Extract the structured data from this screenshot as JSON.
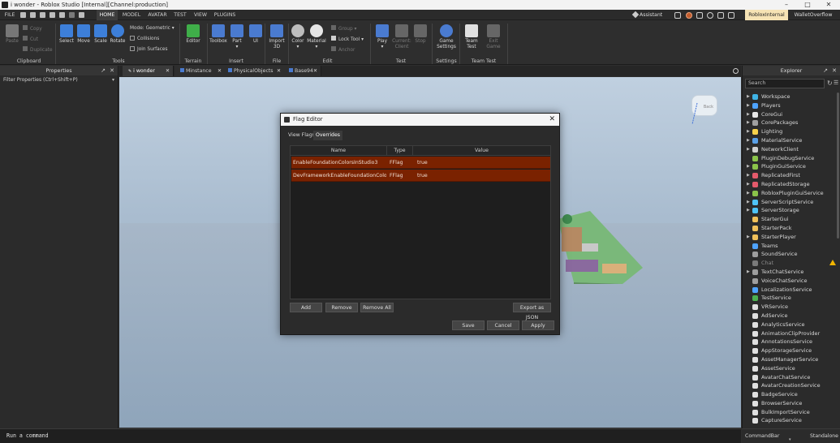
{
  "window": {
    "title": "i wonder - Roblox Studio [Internal][Channel:production]"
  },
  "menu": {
    "file": "FILE",
    "tabs": [
      "HOME",
      "MODEL",
      "AVATAR",
      "TEST",
      "VIEW",
      "PLUGINS"
    ],
    "active_tab": "HOME"
  },
  "topright": {
    "assistant": "Assistant",
    "account": "RobloxInternal",
    "user": "WalletOverflow"
  },
  "ribbon": {
    "clipboard": {
      "paste": "Paste",
      "copy": "Copy",
      "cut": "Cut",
      "duplicate": "Duplicate",
      "group": "Clipboard"
    },
    "tools": {
      "select": "Select",
      "move": "Move",
      "scale": "Scale",
      "rotate": "Rotate",
      "mode_label": "Mode:",
      "mode_value": "Geometric",
      "collisions": "Collisions",
      "join_surfaces": "Join Surfaces",
      "group": "Tools"
    },
    "terrain": {
      "editor": "Editor",
      "group": "Terrain"
    },
    "insert": {
      "toolbox": "Toolbox",
      "part": "Part",
      "ui": "UI",
      "group": "Insert"
    },
    "file": {
      "import3d_1": "Import",
      "import3d_2": "3D",
      "group": "File"
    },
    "edit": {
      "color": "Color",
      "material": "Material",
      "group_btn": "Group",
      "lock_tool": "Lock Tool",
      "anchor": "Anchor",
      "group": "Edit"
    },
    "test": {
      "play": "Play",
      "current_1": "Current:",
      "current_2": "Client",
      "stop": "Stop",
      "group": "Test"
    },
    "settings": {
      "game_1": "Game",
      "game_2": "Settings",
      "group": "Settings"
    },
    "teamtest": {
      "team_1": "Team",
      "team_2": "Test",
      "exit_1": "Exit",
      "exit_2": "Game",
      "group": "Team Test"
    }
  },
  "properties": {
    "title": "Properties",
    "filter": "Filter Properties (Ctrl+Shift+P)"
  },
  "tabs": [
    {
      "label": "i wonder"
    },
    {
      "label": "Minstance"
    },
    {
      "label": "PhysicalObjects"
    },
    {
      "label": "Base94"
    }
  ],
  "viewcube": {
    "label": "Back"
  },
  "explorer": {
    "title": "Explorer",
    "search_placeholder": "Search",
    "items": [
      {
        "label": "Workspace",
        "color": "#3fb3e5",
        "arrow": true
      },
      {
        "label": "Players",
        "color": "#4ea3ff",
        "arrow": true
      },
      {
        "label": "CoreGui",
        "color": "#e8e8e8",
        "arrow": true
      },
      {
        "label": "CorePackages",
        "color": "#a0a0a0",
        "arrow": true
      },
      {
        "label": "Lighting",
        "color": "#f5d14b",
        "arrow": true
      },
      {
        "label": "MaterialService",
        "color": "#5aa0e6",
        "arrow": true
      },
      {
        "label": "NetworkClient",
        "color": "#d0d0d0",
        "arrow": true
      },
      {
        "label": "PluginDebugService",
        "color": "#8bc34a",
        "arrow": false
      },
      {
        "label": "PluginGuiService",
        "color": "#8bc34a",
        "arrow": true
      },
      {
        "label": "ReplicatedFirst",
        "color": "#e55a6b",
        "arrow": true
      },
      {
        "label": "ReplicatedStorage",
        "color": "#e55a6b",
        "arrow": true
      },
      {
        "label": "RobloxPluginGuiService",
        "color": "#8bc34a",
        "arrow": true
      },
      {
        "label": "ServerScriptService",
        "color": "#4fc3f7",
        "arrow": true
      },
      {
        "label": "ServerStorage",
        "color": "#4fc3f7",
        "arrow": true
      },
      {
        "label": "StarterGui",
        "color": "#f0c05a",
        "arrow": false
      },
      {
        "label": "StarterPack",
        "color": "#f0c05a",
        "arrow": false
      },
      {
        "label": "StarterPlayer",
        "color": "#f0c05a",
        "arrow": true
      },
      {
        "label": "Teams",
        "color": "#4ea3ff",
        "arrow": false
      },
      {
        "label": "SoundService",
        "color": "#9e9e9e",
        "arrow": false
      },
      {
        "label": "Chat",
        "color": "#7a7a7a",
        "arrow": false,
        "dim": true,
        "warn": true
      },
      {
        "label": "TextChatService",
        "color": "#9e9e9e",
        "arrow": true
      },
      {
        "label": "VoiceChatService",
        "color": "#9e9e9e",
        "arrow": false
      },
      {
        "label": "LocalizationService",
        "color": "#4ea3ff",
        "arrow": false
      },
      {
        "label": "TestService",
        "color": "#4caf50",
        "arrow": false
      },
      {
        "label": "VRService",
        "color": "#e0e0e0",
        "arrow": false
      },
      {
        "label": "AdService",
        "color": "#e0e0e0",
        "arrow": false
      },
      {
        "label": "AnalyticsService",
        "color": "#e0e0e0",
        "arrow": false
      },
      {
        "label": "AnimationClipProvider",
        "color": "#e0e0e0",
        "arrow": false
      },
      {
        "label": "AnnotationsService",
        "color": "#e0e0e0",
        "arrow": false
      },
      {
        "label": "AppStorageService",
        "color": "#e0e0e0",
        "arrow": false
      },
      {
        "label": "AssetManagerService",
        "color": "#e0e0e0",
        "arrow": false
      },
      {
        "label": "AssetService",
        "color": "#e0e0e0",
        "arrow": false
      },
      {
        "label": "AvatarChatService",
        "color": "#e0e0e0",
        "arrow": false
      },
      {
        "label": "AvatarCreationService",
        "color": "#e0e0e0",
        "arrow": false
      },
      {
        "label": "BadgeService",
        "color": "#e0e0e0",
        "arrow": false
      },
      {
        "label": "BrowserService",
        "color": "#e0e0e0",
        "arrow": false
      },
      {
        "label": "BulkImportService",
        "color": "#e0e0e0",
        "arrow": false
      },
      {
        "label": "CaptureService",
        "color": "#e0e0e0",
        "arrow": false
      }
    ]
  },
  "commandbar": {
    "placeholder": "Run a command"
  },
  "statusbar": {
    "left": "CommandBar",
    "right": "Standalone"
  },
  "dialog": {
    "title": "Flag Editor",
    "tabs": [
      {
        "label": "View Flags"
      },
      {
        "label": "Overrides"
      }
    ],
    "active_tab": "Overrides",
    "columns": [
      "Name",
      "Type",
      "Value"
    ],
    "rows": [
      {
        "name": "EnableFoundationColorsInStudio3",
        "type": "FFlag",
        "value": "true"
      },
      {
        "name": "DevFrameworkEnableFoundationColors3",
        "type": "FFlag",
        "value": "true"
      }
    ],
    "buttons": {
      "add": "Add",
      "remove": "Remove",
      "remove_all": "Remove All",
      "export_json": "Export as JSON",
      "save": "Save",
      "cancel": "Cancel",
      "apply": "Apply"
    },
    "row_color": "#7a2200"
  }
}
